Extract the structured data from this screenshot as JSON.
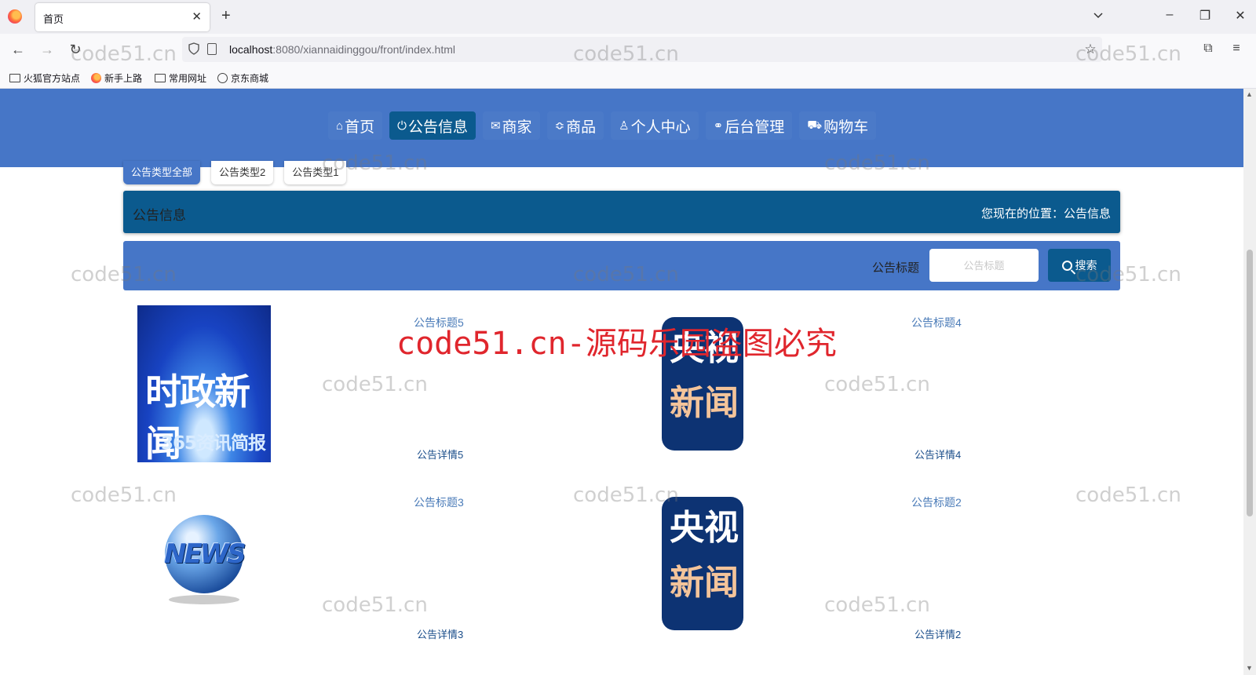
{
  "browser": {
    "tab_title": "首页",
    "url_host": "localhost",
    "url_rest": ":8080/xiannaidinggou/front/index.html",
    "bookmarks": [
      "火狐官方站点",
      "新手上路",
      "常用网址",
      "京东商城"
    ]
  },
  "nav": {
    "items": [
      {
        "icon": "home-icon",
        "glyph": "⌂",
        "label": "首页"
      },
      {
        "icon": "power-icon",
        "glyph": "⏻",
        "label": "公告信息"
      },
      {
        "icon": "mail-icon",
        "glyph": "✉",
        "label": "商家"
      },
      {
        "icon": "sliders-icon",
        "glyph": "≎",
        "label": "商品"
      },
      {
        "icon": "user-icon",
        "glyph": "♙",
        "label": "个人中心"
      },
      {
        "icon": "link-icon",
        "glyph": "🔗",
        "label": "后台管理"
      },
      {
        "icon": "cart-icon",
        "glyph": "🛒",
        "label": "购物车"
      }
    ],
    "active_index": 1,
    "header_color": "#4676c7",
    "active_color": "#0b5a8e"
  },
  "type_tabs": [
    "公告类型全部",
    "公告类型2",
    "公告类型1"
  ],
  "section": {
    "title": "公告信息",
    "location": "您现在的位置：公告信息"
  },
  "search": {
    "label": "公告标题",
    "placeholder": "公告标题",
    "button": "搜索"
  },
  "cards": [
    {
      "title": "公告标题5",
      "detail": "公告详情5",
      "image": "news-banner",
      "img_text1": "时政新闻",
      "img_text2": "365资讯简报"
    },
    {
      "title": "公告标题4",
      "detail": "公告详情4",
      "image": "cctv-news",
      "img_text1": "央视",
      "img_text2": "新闻"
    },
    {
      "title": "公告标题3",
      "detail": "公告详情3",
      "image": "news-globe",
      "img_text1": "NEWS"
    },
    {
      "title": "公告标题2",
      "detail": "公告详情2",
      "image": "cctv-news",
      "img_text1": "央视",
      "img_text2": "新闻"
    }
  ],
  "watermark": {
    "small": "code51.cn",
    "big": "code51.cn-源码乐园盗图必究"
  }
}
